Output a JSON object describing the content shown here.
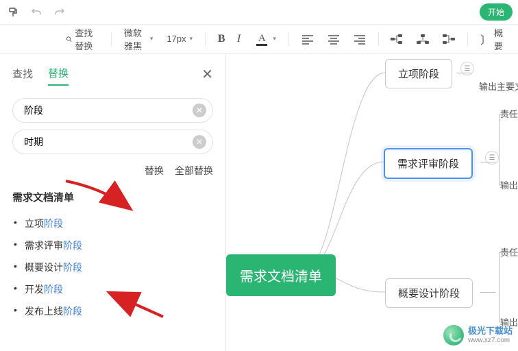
{
  "topbar": {
    "start_label": "开始"
  },
  "toolbar": {
    "search_replace_label": "查找替换",
    "font_name": "微软雅黑",
    "font_size": "17px",
    "outline_label": "概要"
  },
  "panel": {
    "tab_find": "查找",
    "tab_replace": "替换",
    "find_value": "阶段",
    "replace_value": "时期",
    "btn_replace": "替换",
    "btn_replace_all": "全部替换",
    "heading": "需求文档清单",
    "results": [
      {
        "prefix": "立项",
        "match": "阶段"
      },
      {
        "prefix": "需求评审",
        "match": "阶段"
      },
      {
        "prefix": "概要设计",
        "match": "阶段"
      },
      {
        "prefix": "开发",
        "match": "阶段"
      },
      {
        "prefix": "发布上线",
        "match": "阶段"
      }
    ]
  },
  "mindmap": {
    "root": "需求文档清单",
    "nodes": {
      "n1": "立项阶段",
      "n2": "需求评审阶段",
      "n3": "概要设计阶段"
    },
    "subtexts": {
      "s1": "输出主要文档",
      "s2a": "责任人",
      "s2b": "输出主",
      "s3a": "责任人",
      "s3b": "输出主"
    }
  },
  "watermark": {
    "name": "极光下载站",
    "url": "www.xz7.com"
  }
}
